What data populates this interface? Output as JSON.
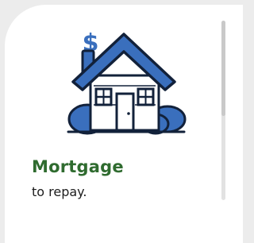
{
  "card": {
    "title": "Mortgage",
    "subtitle": "to repay."
  },
  "illustration": {
    "icon": "house-with-dollar-icon",
    "symbol": "$"
  },
  "colors": {
    "brand_green": "#2f6b2f",
    "roof_blue": "#3a6fbd",
    "outline": "#12213a"
  }
}
